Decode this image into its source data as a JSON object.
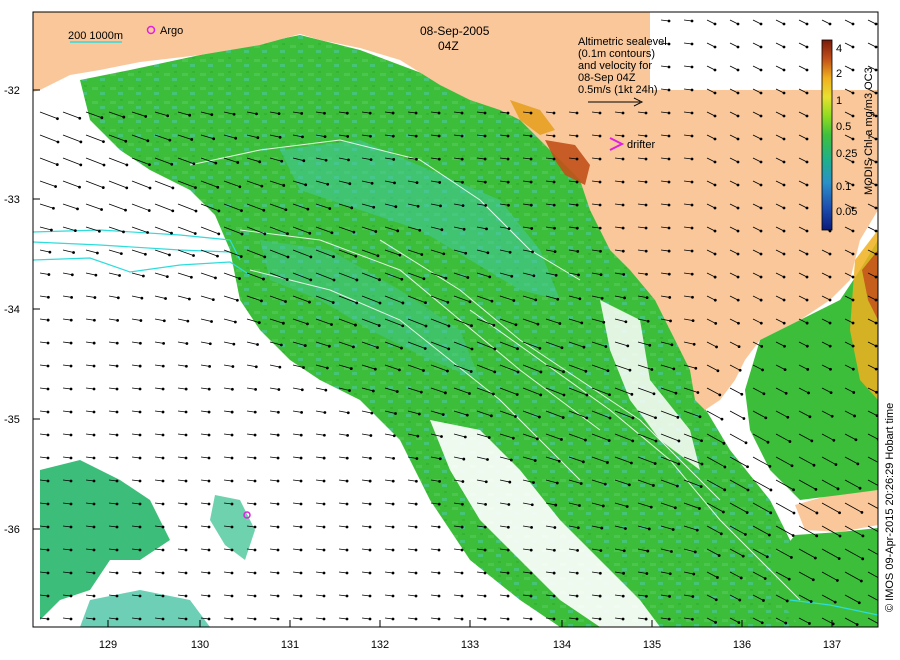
{
  "map": {
    "date": "08-Sep-2005",
    "time": "04Z",
    "lon_ticks": [
      "129",
      "130",
      "131",
      "132",
      "133",
      "134",
      "135",
      "136",
      "137"
    ],
    "lat_ticks": [
      "-32",
      "-33",
      "-34",
      "-35",
      "-36"
    ],
    "scale_label": "200  1000m",
    "argo_label": "Argo",
    "drifter_label": "drifter",
    "altimetry_note": [
      "Altimetric sealevel",
      "(0.1m contours)",
      "and velocity for",
      "08-Sep 04Z",
      "0.5m/s (1kt 24h)"
    ],
    "credit": "© IMOS 09-Apr-2015 20:26:29 Hobart time"
  },
  "colorbar": {
    "title": "MODIS Chl-a mg/m3 OC3",
    "ticks": [
      "4",
      "2",
      "1",
      "0.5",
      "0.25",
      "0.1",
      "0.05"
    ],
    "colors": [
      "#7a1a0a",
      "#c2501a",
      "#f0b020",
      "#e8e030",
      "#8fdc20",
      "#3fc03c",
      "#1fb08a",
      "#2a90c8",
      "#1d4fb0",
      "#0b1a7a"
    ]
  },
  "colors": {
    "land": "#f9c79a",
    "chl_green": "#3dbf3a",
    "chl_teal": "#44c8a0",
    "contour": "#ffffff",
    "isobath": "#2fdcdc",
    "marker": "#e020e0"
  }
}
